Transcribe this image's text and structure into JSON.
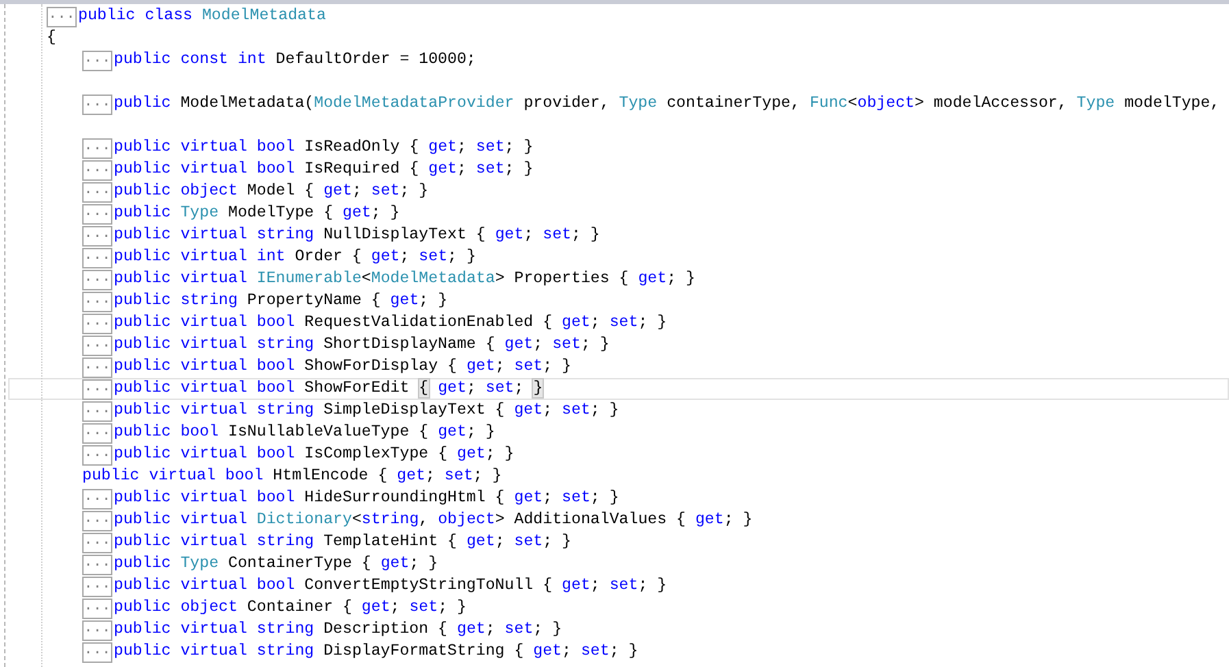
{
  "editor": {
    "lines": [
      {
        "kind": "code",
        "fold": "...",
        "current": false,
        "tokens": [
          {
            "kind": "kw",
            "text": "public class "
          },
          {
            "kind": "type",
            "text": "ModelMetadata"
          }
        ]
      },
      {
        "kind": "code",
        "current": false,
        "tokens": [
          {
            "kind": "plain",
            "text": "{"
          }
        ],
        "children": [
          {
            "kind": "code",
            "fold": "...",
            "current": false,
            "tokens": [
              {
                "kind": "kw",
                "text": "public const int"
              },
              {
                "kind": "plain",
                "text": " DefaultOrder = 10000;"
              }
            ]
          },
          {
            "kind": "blank"
          },
          {
            "kind": "code",
            "fold": "...",
            "current": false,
            "tokens": [
              {
                "kind": "kw",
                "text": "public"
              },
              {
                "kind": "plain",
                "text": " ModelMetadata("
              },
              {
                "kind": "type",
                "text": "ModelMetadataProvider"
              },
              {
                "kind": "plain",
                "text": " provider, "
              },
              {
                "kind": "type",
                "text": "Type"
              },
              {
                "kind": "plain",
                "text": " containerType, "
              },
              {
                "kind": "type",
                "text": "Func"
              },
              {
                "kind": "plain",
                "text": "<"
              },
              {
                "kind": "kw",
                "text": "object"
              },
              {
                "kind": "plain",
                "text": "> modelAccessor, "
              },
              {
                "kind": "type",
                "text": "Type"
              },
              {
                "kind": "plain",
                "text": " modelType,"
              }
            ]
          },
          {
            "kind": "blank"
          },
          {
            "kind": "code",
            "fold": "...",
            "current": false,
            "tokens": [
              {
                "kind": "kw",
                "text": "public virtual bool"
              },
              {
                "kind": "plain",
                "text": " IsReadOnly { "
              },
              {
                "kind": "kw",
                "text": "get"
              },
              {
                "kind": "plain",
                "text": "; "
              },
              {
                "kind": "kw",
                "text": "set"
              },
              {
                "kind": "plain",
                "text": "; }"
              }
            ]
          },
          {
            "kind": "code",
            "fold": "...",
            "current": false,
            "tokens": [
              {
                "kind": "kw",
                "text": "public virtual bool"
              },
              {
                "kind": "plain",
                "text": " IsRequired { "
              },
              {
                "kind": "kw",
                "text": "get"
              },
              {
                "kind": "plain",
                "text": "; "
              },
              {
                "kind": "kw",
                "text": "set"
              },
              {
                "kind": "plain",
                "text": "; }"
              }
            ]
          },
          {
            "kind": "code",
            "fold": "...",
            "current": false,
            "tokens": [
              {
                "kind": "kw",
                "text": "public object"
              },
              {
                "kind": "plain",
                "text": " Model { "
              },
              {
                "kind": "kw",
                "text": "get"
              },
              {
                "kind": "plain",
                "text": "; "
              },
              {
                "kind": "kw",
                "text": "set"
              },
              {
                "kind": "plain",
                "text": "; }"
              }
            ]
          },
          {
            "kind": "code",
            "fold": "...",
            "current": false,
            "tokens": [
              {
                "kind": "kw",
                "text": "public "
              },
              {
                "kind": "type",
                "text": "Type"
              },
              {
                "kind": "plain",
                "text": " ModelType { "
              },
              {
                "kind": "kw",
                "text": "get"
              },
              {
                "kind": "plain",
                "text": "; }"
              }
            ]
          },
          {
            "kind": "code",
            "fold": "...",
            "current": false,
            "tokens": [
              {
                "kind": "kw",
                "text": "public virtual string"
              },
              {
                "kind": "plain",
                "text": " NullDisplayText { "
              },
              {
                "kind": "kw",
                "text": "get"
              },
              {
                "kind": "plain",
                "text": "; "
              },
              {
                "kind": "kw",
                "text": "set"
              },
              {
                "kind": "plain",
                "text": "; }"
              }
            ]
          },
          {
            "kind": "code",
            "fold": "...",
            "current": false,
            "tokens": [
              {
                "kind": "kw",
                "text": "public virtual int"
              },
              {
                "kind": "plain",
                "text": " Order { "
              },
              {
                "kind": "kw",
                "text": "get"
              },
              {
                "kind": "plain",
                "text": "; "
              },
              {
                "kind": "kw",
                "text": "set"
              },
              {
                "kind": "plain",
                "text": "; }"
              }
            ]
          },
          {
            "kind": "code",
            "fold": "...",
            "current": false,
            "tokens": [
              {
                "kind": "kw",
                "text": "public virtual "
              },
              {
                "kind": "type",
                "text": "IEnumerable"
              },
              {
                "kind": "plain",
                "text": "<"
              },
              {
                "kind": "type",
                "text": "ModelMetadata"
              },
              {
                "kind": "plain",
                "text": "> Properties { "
              },
              {
                "kind": "kw",
                "text": "get"
              },
              {
                "kind": "plain",
                "text": "; }"
              }
            ]
          },
          {
            "kind": "code",
            "fold": "...",
            "current": false,
            "tokens": [
              {
                "kind": "kw",
                "text": "public string"
              },
              {
                "kind": "plain",
                "text": " PropertyName { "
              },
              {
                "kind": "kw",
                "text": "get"
              },
              {
                "kind": "plain",
                "text": "; }"
              }
            ]
          },
          {
            "kind": "code",
            "fold": "...",
            "current": false,
            "tokens": [
              {
                "kind": "kw",
                "text": "public virtual bool"
              },
              {
                "kind": "plain",
                "text": " RequestValidationEnabled { "
              },
              {
                "kind": "kw",
                "text": "get"
              },
              {
                "kind": "plain",
                "text": "; "
              },
              {
                "kind": "kw",
                "text": "set"
              },
              {
                "kind": "plain",
                "text": "; }"
              }
            ]
          },
          {
            "kind": "code",
            "fold": "...",
            "current": false,
            "tokens": [
              {
                "kind": "kw",
                "text": "public virtual string"
              },
              {
                "kind": "plain",
                "text": " ShortDisplayName { "
              },
              {
                "kind": "kw",
                "text": "get"
              },
              {
                "kind": "plain",
                "text": "; "
              },
              {
                "kind": "kw",
                "text": "set"
              },
              {
                "kind": "plain",
                "text": "; }"
              }
            ]
          },
          {
            "kind": "code",
            "fold": "...",
            "current": false,
            "tokens": [
              {
                "kind": "kw",
                "text": "public virtual bool"
              },
              {
                "kind": "plain",
                "text": " ShowForDisplay { "
              },
              {
                "kind": "kw",
                "text": "get"
              },
              {
                "kind": "plain",
                "text": "; "
              },
              {
                "kind": "kw",
                "text": "set"
              },
              {
                "kind": "plain",
                "text": "; }"
              }
            ]
          },
          {
            "kind": "code",
            "fold": "...",
            "current": true,
            "tokens": [
              {
                "kind": "kw",
                "text": "public virtual bool"
              },
              {
                "kind": "plain",
                "text": " ShowForEdit "
              },
              {
                "kind": "brace",
                "text": "{"
              },
              {
                "kind": "kw",
                "text": " get"
              },
              {
                "kind": "plain",
                "text": "; "
              },
              {
                "kind": "kw",
                "text": "set"
              },
              {
                "kind": "plain",
                "text": "; "
              },
              {
                "kind": "brace",
                "text": "}"
              }
            ]
          },
          {
            "kind": "code",
            "fold": "...",
            "current": false,
            "tokens": [
              {
                "kind": "kw",
                "text": "public virtual string"
              },
              {
                "kind": "plain",
                "text": " SimpleDisplayText { "
              },
              {
                "kind": "kw",
                "text": "get"
              },
              {
                "kind": "plain",
                "text": "; "
              },
              {
                "kind": "kw",
                "text": "set"
              },
              {
                "kind": "plain",
                "text": "; }"
              }
            ]
          },
          {
            "kind": "code",
            "fold": "...",
            "current": false,
            "tokens": [
              {
                "kind": "kw",
                "text": "public bool"
              },
              {
                "kind": "plain",
                "text": " IsNullableValueType { "
              },
              {
                "kind": "kw",
                "text": "get"
              },
              {
                "kind": "plain",
                "text": "; }"
              }
            ]
          },
          {
            "kind": "code",
            "fold": "...",
            "current": false,
            "tokens": [
              {
                "kind": "kw",
                "text": "public virtual bool"
              },
              {
                "kind": "plain",
                "text": " IsComplexType { "
              },
              {
                "kind": "kw",
                "text": "get"
              },
              {
                "kind": "plain",
                "text": "; }"
              }
            ]
          },
          {
            "kind": "code",
            "current": false,
            "tokens": [
              {
                "kind": "kw",
                "text": "public virtual bool"
              },
              {
                "kind": "plain",
                "text": " HtmlEncode { "
              },
              {
                "kind": "kw",
                "text": "get"
              },
              {
                "kind": "plain",
                "text": "; "
              },
              {
                "kind": "kw",
                "text": "set"
              },
              {
                "kind": "plain",
                "text": "; }"
              }
            ]
          },
          {
            "kind": "code",
            "fold": "...",
            "current": false,
            "tokens": [
              {
                "kind": "kw",
                "text": "public virtual bool"
              },
              {
                "kind": "plain",
                "text": " HideSurroundingHtml { "
              },
              {
                "kind": "kw",
                "text": "get"
              },
              {
                "kind": "plain",
                "text": "; "
              },
              {
                "kind": "kw",
                "text": "set"
              },
              {
                "kind": "plain",
                "text": "; }"
              }
            ]
          },
          {
            "kind": "code",
            "fold": "...",
            "current": false,
            "tokens": [
              {
                "kind": "kw",
                "text": "public virtual "
              },
              {
                "kind": "type",
                "text": "Dictionary"
              },
              {
                "kind": "plain",
                "text": "<"
              },
              {
                "kind": "kw",
                "text": "string"
              },
              {
                "kind": "plain",
                "text": ", "
              },
              {
                "kind": "kw",
                "text": "object"
              },
              {
                "kind": "plain",
                "text": "> AdditionalValues { "
              },
              {
                "kind": "kw",
                "text": "get"
              },
              {
                "kind": "plain",
                "text": "; }"
              }
            ]
          },
          {
            "kind": "code",
            "fold": "...",
            "current": false,
            "tokens": [
              {
                "kind": "kw",
                "text": "public virtual string"
              },
              {
                "kind": "plain",
                "text": " TemplateHint { "
              },
              {
                "kind": "kw",
                "text": "get"
              },
              {
                "kind": "plain",
                "text": "; "
              },
              {
                "kind": "kw",
                "text": "set"
              },
              {
                "kind": "plain",
                "text": "; }"
              }
            ]
          },
          {
            "kind": "code",
            "fold": "...",
            "current": false,
            "tokens": [
              {
                "kind": "kw",
                "text": "public "
              },
              {
                "kind": "type",
                "text": "Type"
              },
              {
                "kind": "plain",
                "text": " ContainerType { "
              },
              {
                "kind": "kw",
                "text": "get"
              },
              {
                "kind": "plain",
                "text": "; }"
              }
            ]
          },
          {
            "kind": "code",
            "fold": "...",
            "current": false,
            "tokens": [
              {
                "kind": "kw",
                "text": "public virtual bool"
              },
              {
                "kind": "plain",
                "text": " ConvertEmptyStringToNull { "
              },
              {
                "kind": "kw",
                "text": "get"
              },
              {
                "kind": "plain",
                "text": "; "
              },
              {
                "kind": "kw",
                "text": "set"
              },
              {
                "kind": "plain",
                "text": "; }"
              }
            ]
          },
          {
            "kind": "code",
            "fold": "...",
            "current": false,
            "tokens": [
              {
                "kind": "kw",
                "text": "public object"
              },
              {
                "kind": "plain",
                "text": " Container { "
              },
              {
                "kind": "kw",
                "text": "get"
              },
              {
                "kind": "plain",
                "text": "; "
              },
              {
                "kind": "kw",
                "text": "set"
              },
              {
                "kind": "plain",
                "text": "; }"
              }
            ]
          },
          {
            "kind": "code",
            "fold": "...",
            "current": false,
            "tokens": [
              {
                "kind": "kw",
                "text": "public virtual string"
              },
              {
                "kind": "plain",
                "text": " Description { "
              },
              {
                "kind": "kw",
                "text": "get"
              },
              {
                "kind": "plain",
                "text": "; "
              },
              {
                "kind": "kw",
                "text": "set"
              },
              {
                "kind": "plain",
                "text": "; }"
              }
            ]
          },
          {
            "kind": "code",
            "fold": "...",
            "current": false,
            "tokens": [
              {
                "kind": "kw",
                "text": "public virtual string"
              },
              {
                "kind": "plain",
                "text": " DisplayFormatString { "
              },
              {
                "kind": "kw",
                "text": "get"
              },
              {
                "kind": "plain",
                "text": "; "
              },
              {
                "kind": "kw",
                "text": "set"
              },
              {
                "kind": "plain",
                "text": "; }"
              }
            ]
          }
        ]
      }
    ]
  }
}
